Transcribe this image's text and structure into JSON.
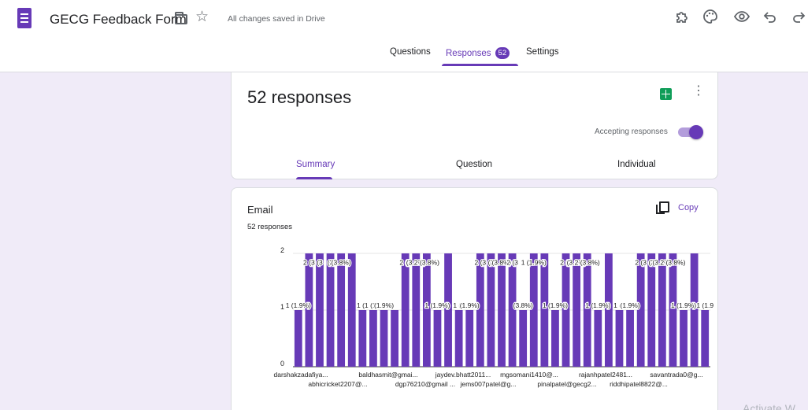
{
  "header": {
    "form_title": "GECG Feedback Form",
    "saved_status": "All changes saved in Drive"
  },
  "tabs": {
    "questions": "Questions",
    "responses": "Responses",
    "responses_badge": "52",
    "settings": "Settings"
  },
  "summary_card": {
    "title": "52 responses",
    "accepting_label": "Accepting responses",
    "accepting": true,
    "subtabs": [
      "Summary",
      "Question",
      "Individual"
    ]
  },
  "email_card": {
    "title": "Email",
    "count": "52 responses",
    "copy_label": "Copy"
  },
  "watermark": "Activate W",
  "icons": [
    "form-icon",
    "folder-icon",
    "star-icon",
    "addons-icon",
    "palette-icon",
    "eye-icon",
    "undo-icon",
    "redo-icon",
    "sheets-icon",
    "more-icon",
    "copy-icon"
  ],
  "colors": {
    "accent": "#673ab7",
    "bar": "#673ab7",
    "sheets": "#0f9d58"
  },
  "chart_data": {
    "type": "bar",
    "ylim": [
      0,
      2
    ],
    "yticks": [
      "0",
      "1",
      "2"
    ],
    "values": [
      1,
      2,
      2,
      2,
      2,
      2,
      1,
      1,
      1,
      1,
      2,
      2,
      2,
      1,
      2,
      1,
      1,
      2,
      2,
      2,
      2,
      1,
      2,
      2,
      1,
      2,
      2,
      2,
      1,
      2,
      1,
      1,
      2,
      2,
      2,
      2,
      1,
      2,
      1
    ],
    "value_labels": [
      "1 (1.9%)",
      "2 (3",
      "(3",
      "(3",
      "(3.8%)",
      "",
      "1 (1",
      "(1",
      "(1.9%)",
      "",
      "2 (3",
      "(3.8%)",
      "2 (3.8%)",
      "1 (1.9%)",
      "",
      "1 (1",
      "(1.9%)",
      "2 (3",
      "(3",
      "(3.8%)",
      "2 (3",
      "(3.8%)",
      "1 (1.9%)",
      "",
      "1 (1.9%)",
      "2 (3",
      "(3.8%)",
      "2 (3.8%)",
      "1 (1.9%)",
      "",
      "1 (1",
      "(1.9%)",
      "2 (3",
      "(3",
      "(3.8%)",
      "2 (3.8%)",
      "1 (1.9%)",
      "",
      "1 (1.9"
    ],
    "x_labels_row1": [
      "darshakzadafiya...",
      "baldhasmit@gmai...",
      "jaydev.bhatt2011...",
      "mgsomani1410@...",
      "rajanhpatel2481...",
      "savantrada0@g..."
    ],
    "x_labels_row2": [
      "abhicricket2207@...",
      "dgp76210@gmail ...",
      "jems007patel@g...",
      "pinalpatel@gecg2...",
      "riddhipatel8822@..."
    ]
  }
}
